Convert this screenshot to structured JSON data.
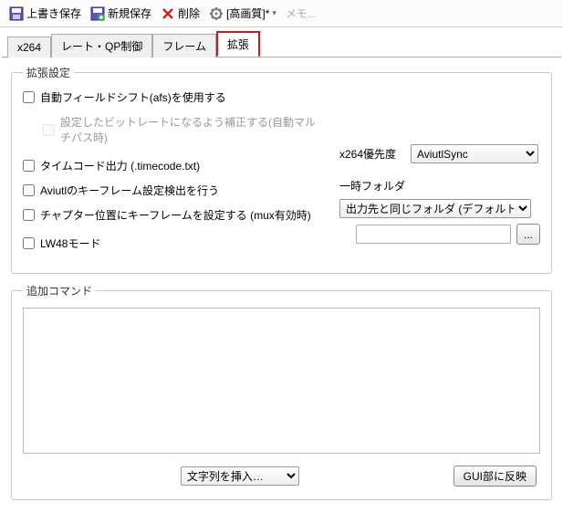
{
  "toolbar": {
    "save_overwrite": "上書き保存",
    "save_new": "新規保存",
    "delete": "削除",
    "preset": "[高画質]*",
    "memo": "メモ..."
  },
  "tabs": {
    "t0": "x264",
    "t1": "レート・QP制御",
    "t2": "フレーム",
    "t3": "拡張"
  },
  "ext": {
    "legend": "拡張設定",
    "afs": "自動フィールドシフト(afs)を使用する",
    "afs_sub": "設定したビットレートになるよう補正する(自動マルチパス時)",
    "timecode": "タイムコード出力 (.timecode.txt)",
    "aviutl_key": "Aviutlのキーフレーム設定検出を行う",
    "chapter_key": "チャプター位置にキーフレームを設定する (mux有効時)",
    "lw48": "LW48モード",
    "priority_label": "x264優先度",
    "priority_value": "AviutlSync",
    "tempfolder_label": "一時フォルダ",
    "tempfolder_value": "出力先と同じフォルダ (デフォルト)",
    "browse": "...",
    "folder_path": ""
  },
  "cmd": {
    "legend": "追加コマンド",
    "text": "",
    "insert_label": "文字列を挿入…",
    "apply": "GUI部に反映"
  }
}
